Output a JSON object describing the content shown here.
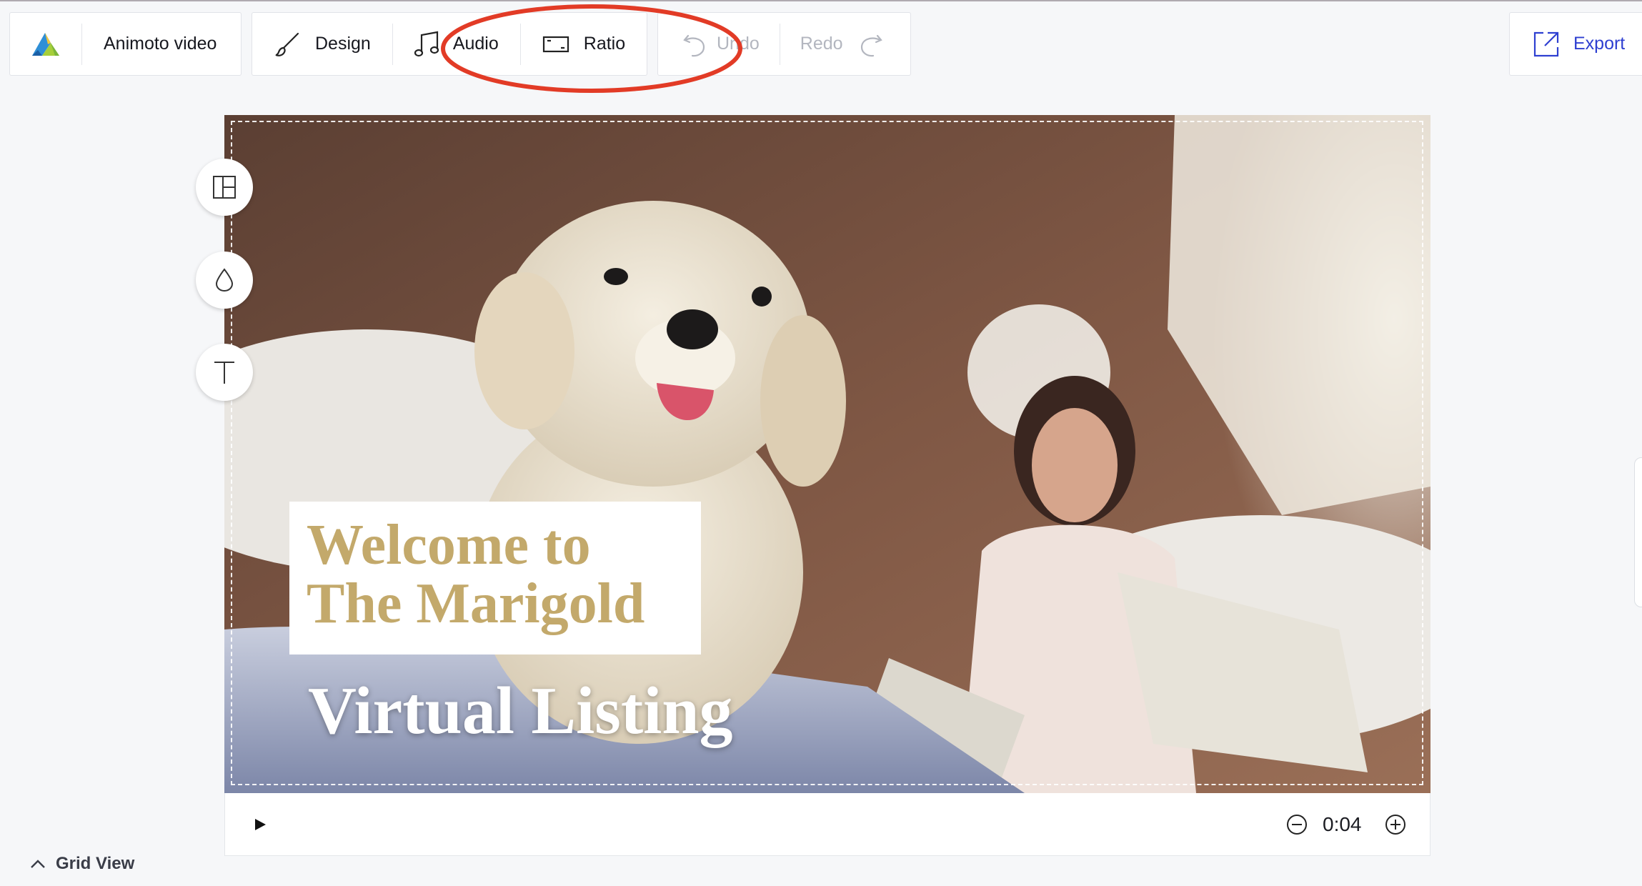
{
  "toolbar": {
    "project_title": "Animoto video",
    "design_label": "Design",
    "audio_label": "Audio",
    "ratio_label": "Ratio",
    "undo_label": "Undo",
    "redo_label": "Redo",
    "export_label": "Export"
  },
  "colors": {
    "accent": "#2e3fd1",
    "title_gold": "#c3a96b",
    "annotation_red": "#e23b26",
    "disabled_text": "#b3b6bf"
  },
  "icons": {
    "logo": "animoto-logo-icon",
    "design": "brush-icon",
    "audio": "music-note-icon",
    "ratio": "aspect-ratio-icon",
    "undo": "undo-arrow-icon",
    "redo": "redo-arrow-icon",
    "export": "export-icon",
    "layout": "layout-icon",
    "color": "droplet-icon",
    "text": "text-icon",
    "play": "play-icon",
    "zoom_out": "minus-circle-icon",
    "zoom_in": "plus-circle-icon",
    "grid_chevron": "chevron-up-icon"
  },
  "canvas": {
    "title_text": "Welcome to\nThe Marigold",
    "subtitle_text": "Virtual Listing"
  },
  "playback": {
    "duration": "0:04"
  },
  "footer": {
    "grid_view_label": "Grid View"
  }
}
